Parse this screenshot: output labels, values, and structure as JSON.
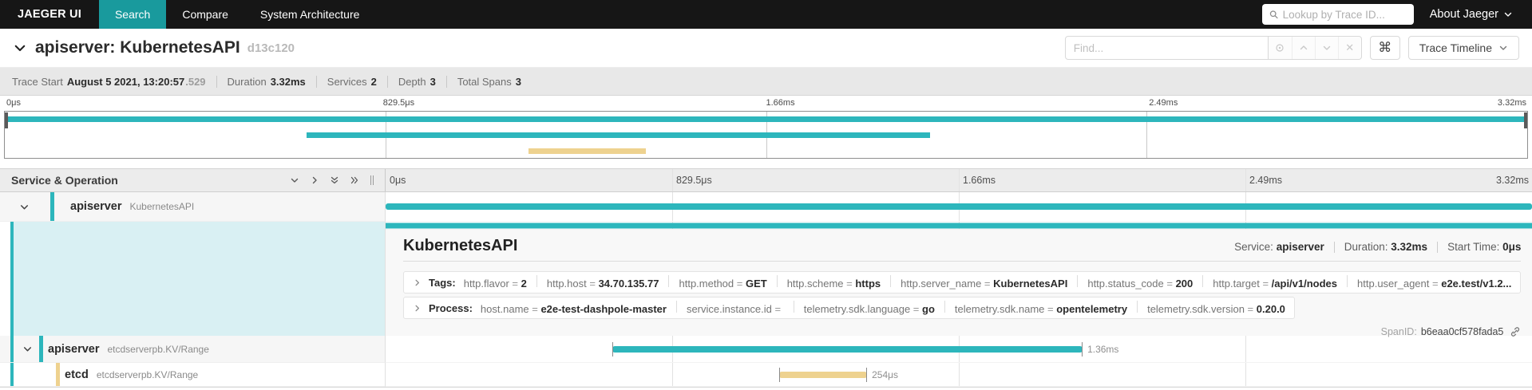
{
  "nav": {
    "brand": "JAEGER UI",
    "tabs": [
      {
        "label": "Search",
        "active": true
      },
      {
        "label": "Compare",
        "active": false
      },
      {
        "label": "System Architecture",
        "active": false
      }
    ],
    "trace_search_placeholder": "Lookup by Trace ID...",
    "about_label": "About Jaeger"
  },
  "trace_header": {
    "title": "apiserver: KubernetesAPI",
    "trace_id_short": "d13c120",
    "find_placeholder": "Find...",
    "view_selector_label": "Trace Timeline"
  },
  "summary": {
    "trace_start_label": "Trace Start",
    "trace_start_value": "August 5 2021, 13:20:57",
    "trace_start_ms": ".529",
    "duration_label": "Duration",
    "duration_value": "3.32ms",
    "services_label": "Services",
    "services_value": "2",
    "depth_label": "Depth",
    "depth_value": "3",
    "total_spans_label": "Total Spans",
    "total_spans_value": "3"
  },
  "timeline": {
    "ticks": [
      "0μs",
      "829.5μs",
      "1.66ms",
      "2.49ms",
      "3.32ms"
    ],
    "minimap_bars": [
      {
        "start_pct": 0,
        "width_pct": 100,
        "color": "#2db6bc"
      },
      {
        "start_pct": 19.8,
        "width_pct": 41.0,
        "color": "#2db6bc"
      },
      {
        "start_pct": 34.4,
        "width_pct": 7.7,
        "color": "#eed28f"
      }
    ]
  },
  "grid": {
    "header_left": "Service & Operation"
  },
  "spans": {
    "row1": {
      "service": "apiserver",
      "operation": "KubernetesAPI",
      "bar": {
        "start_pct": 0,
        "width_pct": 100,
        "color": "#2db6bc"
      }
    },
    "selected_bar": {
      "start_pct": 0,
      "width_pct": 100,
      "color": "#2db6bc"
    },
    "row2": {
      "service": "apiserver",
      "operation": "etcdserverpb.KV/Range",
      "duration": "1.36ms",
      "bar": {
        "start_pct": 19.8,
        "width_pct": 41.0,
        "color": "#2db6bc"
      }
    },
    "row3": {
      "service": "etcd",
      "operation": "etcdserverpb.KV/Range",
      "duration": "254μs",
      "bar": {
        "start_pct": 34.35,
        "width_pct": 7.65,
        "color": "#eed28f"
      }
    }
  },
  "detail": {
    "title": "KubernetesAPI",
    "meta": {
      "service_label": "Service:",
      "service": "apiserver",
      "duration_label": "Duration:",
      "duration": "3.32ms",
      "start_label": "Start Time:",
      "start": "0μs"
    },
    "tags_label": "Tags:",
    "tags": [
      {
        "key": "http.flavor",
        "value": "2"
      },
      {
        "key": "http.host",
        "value": "34.70.135.77"
      },
      {
        "key": "http.method",
        "value": "GET"
      },
      {
        "key": "http.scheme",
        "value": "https"
      },
      {
        "key": "http.server_name",
        "value": "KubernetesAPI"
      },
      {
        "key": "http.status_code",
        "value": "200"
      },
      {
        "key": "http.target",
        "value": "/api/v1/nodes"
      },
      {
        "key": "http.user_agent",
        "value": "e2e.test/v1.2..."
      }
    ],
    "process_label": "Process:",
    "process": [
      {
        "key": "host.name",
        "value": "e2e-test-dashpole-master"
      },
      {
        "key": "service.instance.id",
        "value": ""
      },
      {
        "key": "telemetry.sdk.language",
        "value": "go"
      },
      {
        "key": "telemetry.sdk.name",
        "value": "opentelemetry"
      },
      {
        "key": "telemetry.sdk.version",
        "value": "0.20.0"
      }
    ],
    "spanid_label": "SpanID:",
    "spanid": "b6eaa0cf578fada5"
  },
  "colors": {
    "nav_accent": "#199a9d",
    "span_teal": "#2db6bc",
    "span_yellow": "#eed28f",
    "selected_row_bg": "#d9f0f3"
  }
}
